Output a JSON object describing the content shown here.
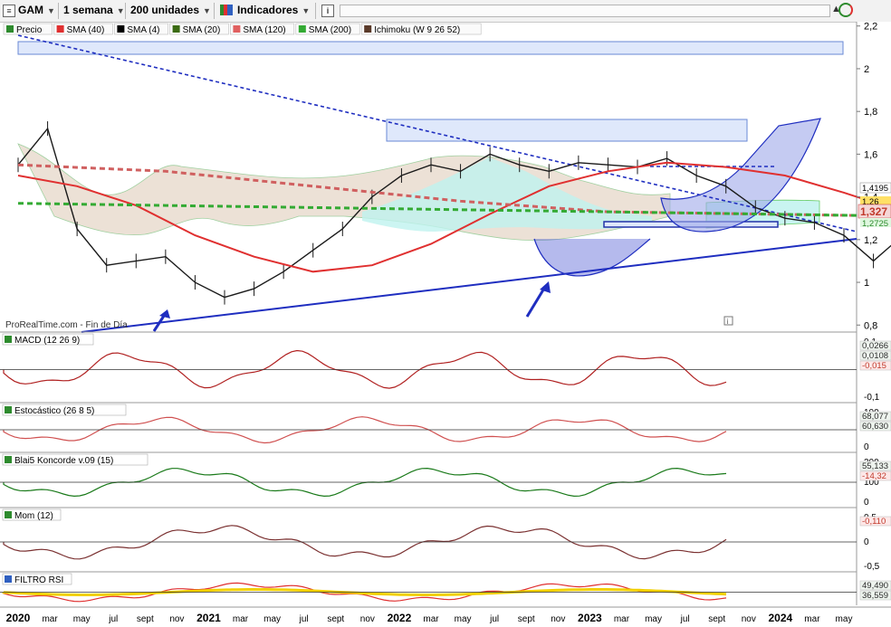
{
  "toolbar": {
    "symbol": "GAM",
    "timeframe": "1 semana",
    "units": "200 unidades",
    "indicators": "Indicadores",
    "info_icon": "i"
  },
  "legend": [
    {
      "label": "Precio",
      "color": "#2e8b2e"
    },
    {
      "label": "SMA (40)",
      "color": "#e03030"
    },
    {
      "label": "SMA (4)",
      "color": "#000000"
    },
    {
      "label": "SMA (20)",
      "color": "#3b6b14"
    },
    {
      "label": "SMA (120)",
      "color": "#e06060"
    },
    {
      "label": "SMA (200)",
      "color": "#33aa33"
    },
    {
      "label": "Ichimoku (W 9 26 52)",
      "color": "#5a3a2a"
    }
  ],
  "watermark": "ProRealTime.com - Fin de Día",
  "price_box": {
    "current": "1,327",
    "high": "1,4195",
    "mid": "1,26",
    "low": "1,2725"
  },
  "panels": [
    {
      "title": "MACD (12 26 9)",
      "ticks": [
        "0,1",
        "-0,1"
      ],
      "values": [
        "0,0266",
        "0,0108",
        "-0,015"
      ]
    },
    {
      "title": "Estocástico (26 8 5)",
      "ticks": [
        "100",
        "0"
      ],
      "values": [
        "68,077",
        "60,630"
      ]
    },
    {
      "title": "Blai5 Koncorde v.09 (15)",
      "ticks": [
        "200",
        "100",
        "0"
      ],
      "values": [
        "55,133",
        "-14,32"
      ]
    },
    {
      "title": "Mom (12)",
      "ticks": [
        "0,5",
        "0",
        "-0,5"
      ],
      "values": [
        "-0,110"
      ]
    },
    {
      "title": "FILTRO RSI",
      "ticks": [],
      "values": [
        "49,490",
        "36,559"
      ]
    }
  ],
  "chart_data": {
    "type": "line",
    "title": "GAM",
    "price_axis_ticks": [
      "2,2",
      "2",
      "1,8",
      "1,6",
      "1,4",
      "1,2",
      "1",
      "0,8"
    ],
    "ylim": [
      0.78,
      2.22
    ],
    "x_labels": [
      "2020",
      "mar",
      "may",
      "jul",
      "sept",
      "nov",
      "2021",
      "mar",
      "may",
      "jul",
      "sept",
      "nov",
      "2022",
      "mar",
      "may",
      "jul",
      "sept",
      "nov",
      "2023",
      "mar",
      "may",
      "jul",
      "sept",
      "nov",
      "2024",
      "mar",
      "may"
    ],
    "series": [
      {
        "name": "Precio",
        "x": [
          "2020-01",
          "2020-02",
          "2020-03",
          "2020-04",
          "2020-05",
          "2020-06",
          "2020-07",
          "2020-08",
          "2020-09",
          "2020-10",
          "2020-11",
          "2020-12",
          "2021-01",
          "2021-02",
          "2021-03",
          "2021-04",
          "2021-05",
          "2021-06",
          "2021-07",
          "2021-08",
          "2021-09",
          "2021-10",
          "2021-11",
          "2021-12",
          "2022-01",
          "2022-02",
          "2022-03",
          "2022-04",
          "2022-05",
          "2022-06",
          "2022-07",
          "2022-08",
          "2022-09",
          "2022-10",
          "2022-11",
          "2022-12",
          "2023-01",
          "2023-02",
          "2023-03",
          "2023-04",
          "2023-05",
          "2023-06",
          "2023-07",
          "2023-08",
          "2023-09"
        ],
        "values": [
          1.55,
          1.72,
          1.25,
          1.08,
          1.1,
          1.12,
          1.0,
          0.93,
          0.97,
          1.05,
          1.15,
          1.25,
          1.4,
          1.5,
          1.55,
          1.52,
          1.6,
          1.55,
          1.52,
          1.56,
          1.55,
          1.54,
          1.58,
          1.5,
          1.45,
          1.35,
          1.3,
          1.28,
          1.22,
          1.1,
          1.22,
          1.3,
          1.05,
          1.08,
          1.12,
          1.18,
          1.22,
          1.35,
          1.48,
          1.42,
          1.45,
          1.44,
          1.46,
          1.4,
          1.33
        ]
      },
      {
        "name": "SMA (40)",
        "x": [
          "2020-01",
          "2020-03",
          "2020-05",
          "2020-07",
          "2020-09",
          "2020-11",
          "2021-01",
          "2021-03",
          "2021-05",
          "2021-07",
          "2021-09",
          "2021-11",
          "2022-01",
          "2022-03",
          "2022-05",
          "2022-07",
          "2022-09",
          "2022-11",
          "2023-01",
          "2023-03",
          "2023-05",
          "2023-07",
          "2023-09"
        ],
        "values": [
          1.5,
          1.45,
          1.36,
          1.22,
          1.12,
          1.05,
          1.08,
          1.18,
          1.32,
          1.45,
          1.52,
          1.56,
          1.54,
          1.5,
          1.42,
          1.33,
          1.28,
          1.22,
          1.2,
          1.26,
          1.32,
          1.35,
          1.37
        ]
      },
      {
        "name": "SMA (120)",
        "x": [
          "2020-01",
          "2020-06",
          "2020-11",
          "2021-04",
          "2021-09",
          "2022-02",
          "2022-07",
          "2022-12",
          "2023-05",
          "2023-09"
        ],
        "values": [
          1.55,
          1.52,
          1.45,
          1.38,
          1.33,
          1.32,
          1.31,
          1.3,
          1.3,
          1.3
        ]
      },
      {
        "name": "SMA (200)",
        "x": [
          "2020-01",
          "2020-06",
          "2020-11",
          "2021-04",
          "2021-09",
          "2022-02",
          "2022-07",
          "2022-12",
          "2023-05",
          "2023-09"
        ],
        "values": [
          1.37,
          1.36,
          1.35,
          1.34,
          1.33,
          1.32,
          1.31,
          1.3,
          1.29,
          1.28
        ]
      }
    ]
  }
}
